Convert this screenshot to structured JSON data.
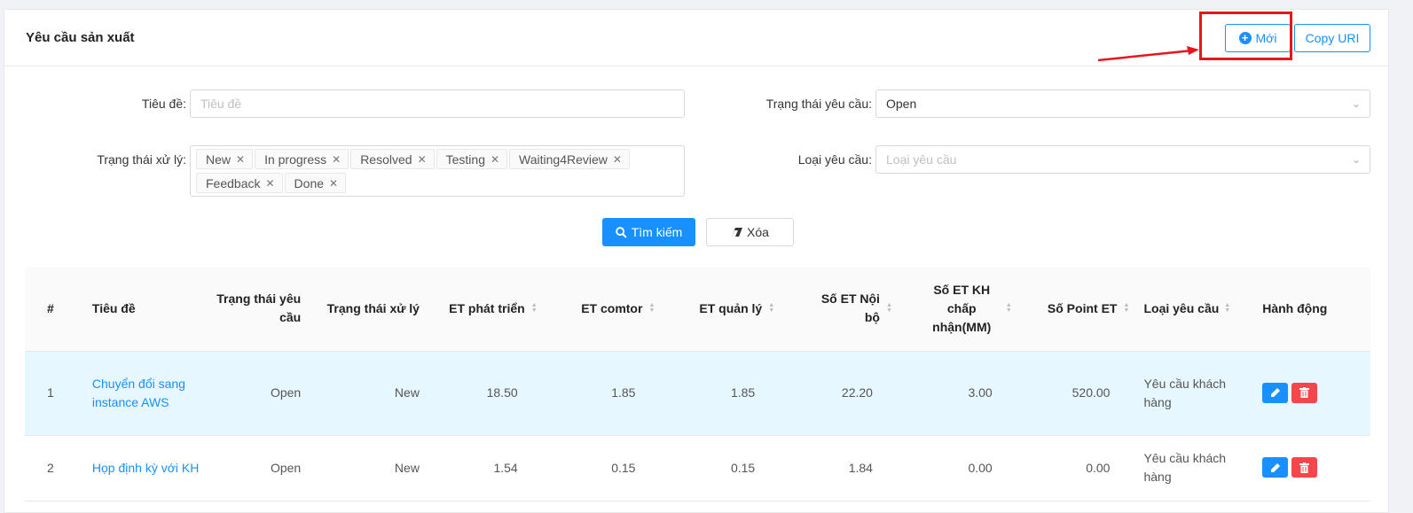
{
  "header": {
    "title": "Yêu cầu sản xuất",
    "new_label": "Mới",
    "copy_label": "Copy URI"
  },
  "filters": {
    "title_label": "Tiêu đề:",
    "title_placeholder": "Tiêu đề",
    "req_status_label": "Trạng thái yêu cầu:",
    "req_status_value": "Open",
    "proc_status_label": "Trạng thái xử lý:",
    "proc_status_tags": [
      "New",
      "In progress",
      "Resolved",
      "Testing",
      "Waiting4Review",
      "Feedback",
      "Done"
    ],
    "req_type_label": "Loại yêu cầu:",
    "req_type_placeholder": "Loại yêu cầu",
    "search_label": "Tìm kiếm",
    "clear_label": "Xóa"
  },
  "table": {
    "columns": [
      "#",
      "Tiêu đề",
      "Trạng thái yêu cầu",
      "Trạng thái xử lý",
      "ET phát triển",
      "ET comtor",
      "ET quản lý",
      "Số ET Nội bộ",
      "Số ET KH chấp nhận(MM)",
      "Số Point ET",
      "Loại yêu cầu",
      "Hành động"
    ],
    "rows": [
      {
        "no": "1",
        "title": "Chuyển đổi sang instance AWS",
        "req_status": "Open",
        "proc_status": "New",
        "et_dev": "18.50",
        "et_comtor": "1.85",
        "et_mgmt": "1.85",
        "et_internal": "22.20",
        "et_customer": "3.00",
        "point": "520.00",
        "type": "Yêu cầu khách hàng"
      },
      {
        "no": "2",
        "title": "Họp định kỳ với KH",
        "req_status": "Open",
        "proc_status": "New",
        "et_dev": "1.54",
        "et_comtor": "0.15",
        "et_mgmt": "0.15",
        "et_internal": "1.84",
        "et_customer": "0.00",
        "point": "0.00",
        "type": "Yêu cầu khách hàng"
      }
    ]
  },
  "colors": {
    "primary": "#1890ff",
    "danger": "#f5474b",
    "annotation": "#e8161b",
    "row_highlight": "#e6f7ff"
  }
}
